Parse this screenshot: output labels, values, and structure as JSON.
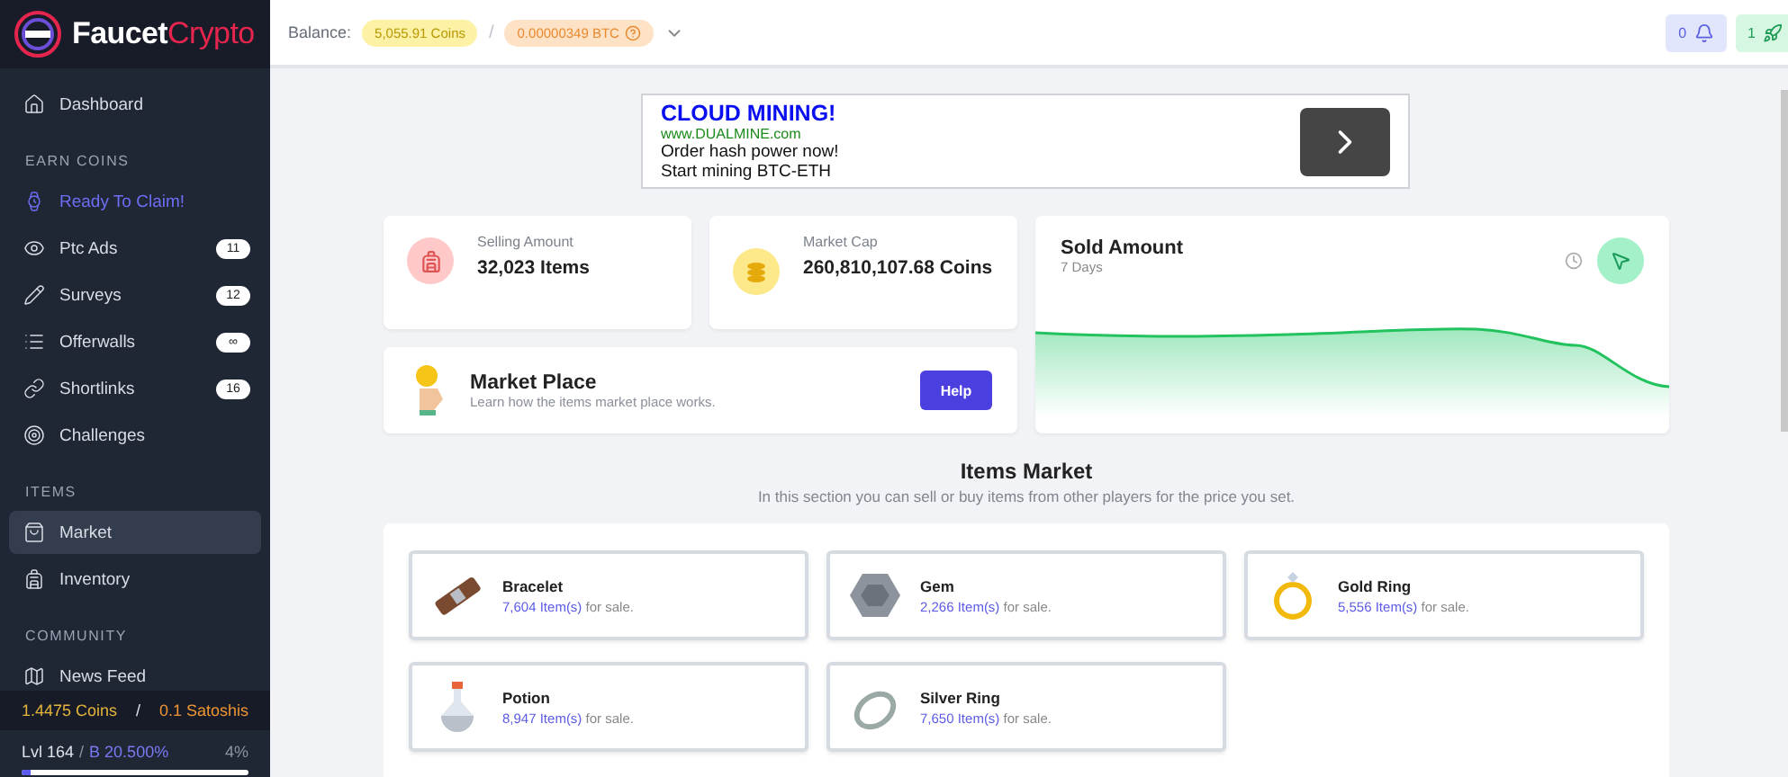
{
  "logo": {
    "part1": "Faucet",
    "part2": "Crypto"
  },
  "header": {
    "balance_label": "Balance:",
    "coins": "5,055.91 Coins",
    "separator": "/",
    "btc": "0.00000349 BTC",
    "notifications": "0",
    "rockets": "1"
  },
  "sidebar": {
    "groups": [
      {
        "items": [
          {
            "label": "Dashboard",
            "kind": "link",
            "selected": false
          }
        ]
      },
      {
        "heading": "EARN COINS",
        "items": [
          {
            "label": "Ready To Claim!",
            "kind": "claim",
            "selected": false
          },
          {
            "label": "Ptc Ads",
            "kind": "link",
            "badge": "11",
            "selected": false
          },
          {
            "label": "Surveys",
            "kind": "link",
            "badge": "12",
            "selected": false
          },
          {
            "label": "Offerwalls",
            "kind": "link",
            "badge": "∞",
            "selected": false
          },
          {
            "label": "Shortlinks",
            "kind": "link",
            "badge": "16",
            "selected": false
          },
          {
            "label": "Challenges",
            "kind": "link",
            "selected": false
          }
        ]
      },
      {
        "heading": "ITEMS",
        "items": [
          {
            "label": "Market",
            "kind": "link",
            "selected": true
          },
          {
            "label": "Inventory",
            "kind": "link",
            "selected": false
          }
        ]
      },
      {
        "heading": "COMMUNITY",
        "items": [
          {
            "label": "News Feed",
            "kind": "link",
            "selected": false
          }
        ]
      }
    ],
    "footer": {
      "coins": "1.4475 Coins",
      "separator": "/",
      "satoshis": "0.1 Satoshis",
      "level": "Lvl 164",
      "level_separator": "/",
      "boost": "B 20.500%",
      "percent": "4%",
      "progress": {
        "level": 0.04
      }
    }
  },
  "ad": {
    "title": "CLOUD MINING!",
    "url": "www.DUALMINE.com",
    "line1": "Order hash power now!",
    "line2": "Start mining BTC-ETH"
  },
  "stats": [
    {
      "label": "Selling Amount",
      "value": "32,023 Items"
    },
    {
      "label": "Market Cap",
      "value": "260,810,107.68 Coins"
    }
  ],
  "sold_card": {
    "title": "Sold Amount",
    "subtitle": "7 Days"
  },
  "market_place": {
    "title": "Market Place",
    "description": "Learn how the items market place works.",
    "button": "Help"
  },
  "items_market": {
    "title": "Items Market",
    "subtitle": "In this section you can sell or buy items from other players for the price you set.",
    "items": [
      {
        "name": "Bracelet",
        "count": "7,604 Item(s)",
        "suffix": "for sale."
      },
      {
        "name": "Gem",
        "count": "2,266 Item(s)",
        "suffix": "for sale."
      },
      {
        "name": "Gold Ring",
        "count": "5,556 Item(s)",
        "suffix": "for sale."
      },
      {
        "name": "Potion",
        "count": "8,947 Item(s)",
        "suffix": "for sale."
      },
      {
        "name": "Silver Ring",
        "count": "7,650 Item(s)",
        "suffix": "for sale."
      }
    ]
  }
}
